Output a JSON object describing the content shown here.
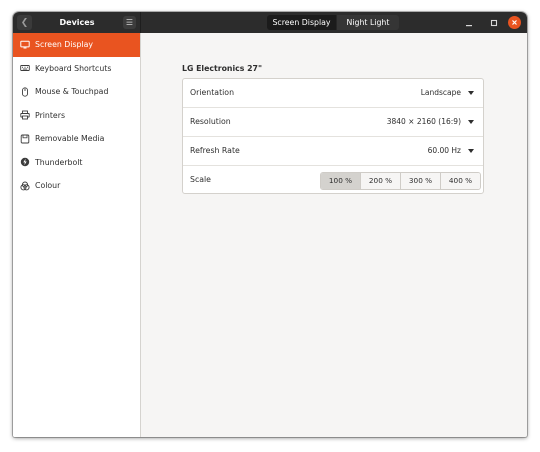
{
  "header": {
    "back_icon": "chevron-left-icon",
    "title": "Devices",
    "menu_icon": "hamburger-menu-icon",
    "tabs": [
      {
        "label": "Screen Display",
        "active": true
      },
      {
        "label": "Night Light",
        "active": false
      }
    ],
    "window_controls": [
      "minimize-icon",
      "maximize-icon",
      "close-icon"
    ]
  },
  "sidebar": {
    "items": [
      {
        "label": "Screen Display",
        "icon": "display-icon",
        "selected": true
      },
      {
        "label": "Keyboard Shortcuts",
        "icon": "keyboard-icon",
        "selected": false
      },
      {
        "label": "Mouse & Touchpad",
        "icon": "mouse-icon",
        "selected": false
      },
      {
        "label": "Printers",
        "icon": "printer-icon",
        "selected": false
      },
      {
        "label": "Removable Media",
        "icon": "removable-media-icon",
        "selected": false
      },
      {
        "label": "Thunderbolt",
        "icon": "thunderbolt-icon",
        "selected": false
      },
      {
        "label": "Colour",
        "icon": "colour-icon",
        "selected": false
      }
    ]
  },
  "main": {
    "monitor_name": "LG Electronics 27\"",
    "orientation": {
      "label": "Orientation",
      "value": "Landscape"
    },
    "resolution": {
      "label": "Resolution",
      "value": "3840 × 2160 (16:9)"
    },
    "refresh_rate": {
      "label": "Refresh Rate",
      "value": "60.00 Hz"
    },
    "scale": {
      "label": "Scale",
      "options": [
        "100 %",
        "200 %",
        "300 %",
        "400 %"
      ],
      "selected": "100 %"
    }
  },
  "colors": {
    "accent": "#e95420",
    "headerbar": "#2c2c2c",
    "content_bg": "#f6f5f4"
  }
}
